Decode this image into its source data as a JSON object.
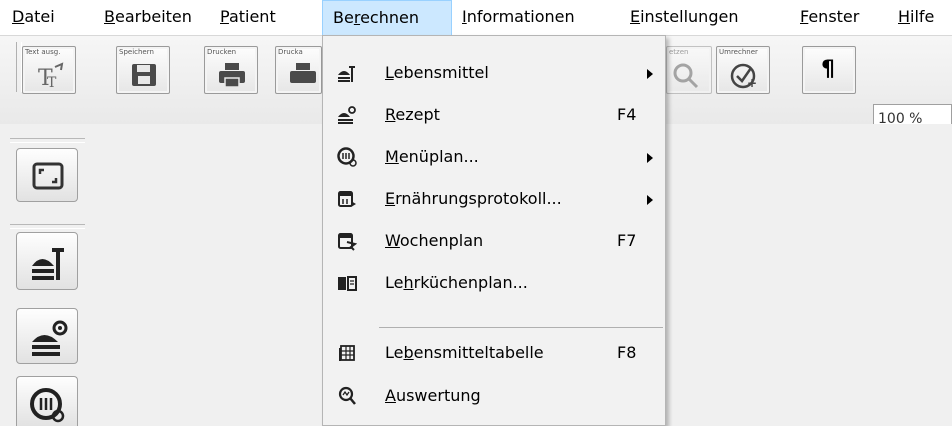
{
  "menubar": {
    "items": [
      {
        "pre": "",
        "acc": "D",
        "post": "atei",
        "left": 0
      },
      {
        "pre": "",
        "acc": "B",
        "post": "earbeiten",
        "left": 0
      },
      {
        "pre": "",
        "acc": "P",
        "post": "atient",
        "left": 0
      },
      {
        "pre": "Be",
        "acc": "r",
        "post": "echnen",
        "left": 0
      },
      {
        "pre": "",
        "acc": "I",
        "post": "nformationen",
        "left": 0
      },
      {
        "pre": "",
        "acc": "E",
        "post": "instellungen",
        "left": 0
      },
      {
        "pre": "",
        "acc": "F",
        "post": "enster",
        "left": 0
      },
      {
        "pre": "",
        "acc": "H",
        "post": "ilfe",
        "left": 0
      }
    ]
  },
  "toolbar": {
    "buttons": [
      {
        "label": "Text ausg.",
        "icon": "text-format-icon"
      },
      {
        "label": "Speichern",
        "icon": "save-icon"
      },
      {
        "label": "Drucken",
        "icon": "print-icon"
      },
      {
        "label": "Drucka",
        "icon": "print-preview-icon"
      },
      {
        "label": "etzen",
        "icon": "search-icon"
      },
      {
        "label": "Umrechner",
        "icon": "convert-icon"
      },
      {
        "label": "",
        "icon": "pilcrow-icon",
        "glyph": "¶"
      }
    ],
    "zoom_value": "100 %"
  },
  "dropdown": {
    "items": [
      {
        "pre": "",
        "acc": "L",
        "post": "ebensmittel",
        "shortcut": "",
        "submenu": true,
        "icon": "food-icon"
      },
      {
        "pre": "",
        "acc": "R",
        "post": "ezept",
        "shortcut": "F4",
        "submenu": false,
        "icon": "recipe-icon"
      },
      {
        "pre": "",
        "acc": "M",
        "post": "enüplan...",
        "shortcut": "",
        "submenu": true,
        "icon": "menu-plan-icon"
      },
      {
        "pre": "",
        "acc": "E",
        "post": "rnährungsprotokoll...",
        "shortcut": "",
        "submenu": true,
        "icon": "nutrition-log-icon"
      },
      {
        "pre": "",
        "acc": "W",
        "post": "ochenplan",
        "shortcut": "F7",
        "submenu": false,
        "icon": "week-plan-icon"
      },
      {
        "pre": "Le",
        "acc": "h",
        "post": "rküchenplan...",
        "shortcut": "",
        "submenu": false,
        "icon": "teaching-kitchen-icon"
      },
      {
        "pre": "Le",
        "acc": "b",
        "post": "ensmitteltabelle",
        "shortcut": "F8",
        "submenu": false,
        "icon": "food-table-icon"
      },
      {
        "pre": "",
        "acc": "A",
        "post": "uswertung",
        "shortcut": "",
        "submenu": false,
        "icon": "evaluation-icon"
      }
    ]
  }
}
